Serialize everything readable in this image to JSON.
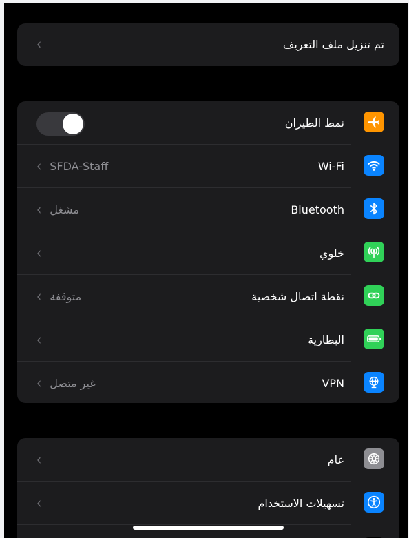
{
  "profile": {
    "label": "تم تنزيل ملف التعريف"
  },
  "connectivity": {
    "items": [
      {
        "label": "نمط الطيران",
        "value": "",
        "icon": "airplane-icon",
        "color": "#ff9500"
      },
      {
        "label": "Wi-Fi",
        "value": "SFDA-Staff",
        "icon": "wifi-icon",
        "color": "#0a84ff"
      },
      {
        "label": "Bluetooth",
        "value": "مشغل",
        "icon": "bluetooth-icon",
        "color": "#0a84ff"
      },
      {
        "label": "خلوي",
        "value": "",
        "icon": "cellular-icon",
        "color": "#30d158"
      },
      {
        "label": "نقطة اتصال شخصية",
        "value": "متوقفة",
        "icon": "hotspot-icon",
        "color": "#30d158"
      },
      {
        "label": "البطارية",
        "value": "",
        "icon": "battery-icon",
        "color": "#30d158"
      },
      {
        "label": "VPN",
        "value": "غير متصل",
        "icon": "vpn-globe-icon",
        "color": "#0a84ff"
      }
    ],
    "airplane_mode_on": false
  },
  "general": {
    "items": [
      {
        "label": "عام",
        "icon": "gear-icon",
        "color": "#8e8e93"
      },
      {
        "label": "تسهيلات الاستخدام",
        "icon": "accessibility-icon",
        "color": "#0a84ff"
      }
    ]
  },
  "glyphs": {
    "chevron": "‹"
  }
}
